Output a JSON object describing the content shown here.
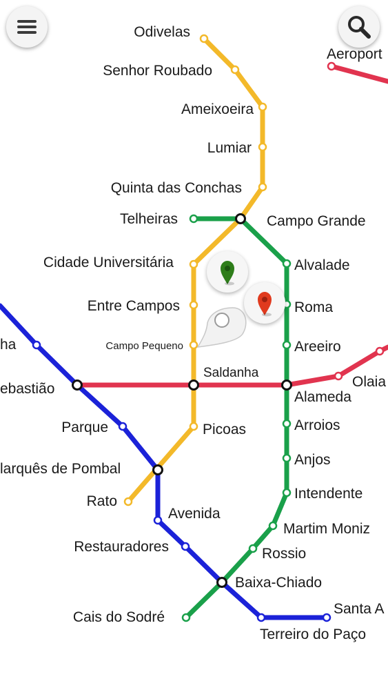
{
  "toolbar": {
    "menu_icon": "hamburger-menu-icon",
    "search_icon": "magnifier-search-icon"
  },
  "lines": {
    "yellow": {
      "color": "#f3b92a"
    },
    "green": {
      "color": "#1aa04a"
    },
    "blue": {
      "color": "#1b22d8"
    },
    "red": {
      "color": "#e1344f"
    }
  },
  "pins": {
    "origin": {
      "icon": "green-map-pin-icon",
      "color": "#2e7d1a"
    },
    "destination": {
      "icon": "red-map-pin-icon",
      "color": "#e03a1e"
    },
    "current": {
      "icon": "white-location-callout-icon"
    }
  },
  "stations": {
    "odivelas": "Odivelas",
    "senhor_roubado": "Senhor Roubado",
    "ameixoeira": "Ameixoeira",
    "lumiar": "Lumiar",
    "quinta_das_conchas": "Quinta das Conchas",
    "telheiras": "Telheiras",
    "campo_grande": "Campo Grande",
    "cidade_universitaria": "Cidade Universitária",
    "alvalade": "Alvalade",
    "entre_campos": "Entre Campos",
    "roma": "Roma",
    "campo_pequeno": "Campo Pequeno",
    "areeiro": "Areeiro",
    "saldanha": "Saldanha",
    "alameda": "Alameda",
    "olaias": "Olaia",
    "sao_sebastiao": "ebastião",
    "praca_espanha": "ha",
    "parque": "Parque",
    "arroios": "Arroios",
    "picoas": "Picoas",
    "anjos": "Anjos",
    "marques_de_pombal": "larquês de Pombal",
    "rato": "Rato",
    "intendente": "Intendente",
    "avenida": "Avenida",
    "martim_moniz": "Martim Moniz",
    "restauradores": "Restauradores",
    "rossio": "Rossio",
    "baixa_chiado": "Baixa-Chiado",
    "cais_do_sodre": "Cais do Sodré",
    "santa_apolonia": "Santa A",
    "terreiro_do_paco": "Terreiro do Paço",
    "aeroporto": "Aeroport"
  }
}
